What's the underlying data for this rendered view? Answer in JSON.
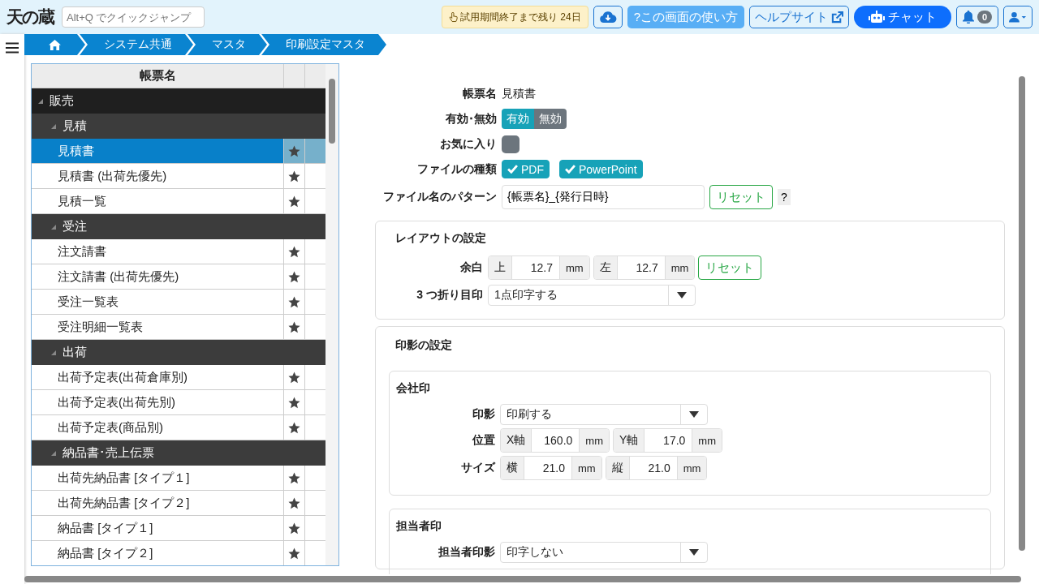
{
  "header": {
    "logo": "天の蔵",
    "quick_jump": {
      "placeholder": "Alt+Q でクイックジャンプ"
    },
    "trial_badge": "試用期間終了まで残り 24日",
    "usage_button": "?この画面の使い方",
    "help_site_button": "ヘルプサイト",
    "chat_button": "チャット",
    "notification_count": "0"
  },
  "breadcrumb": [
    "システム共通",
    "マスタ",
    "印刷設定マスタ"
  ],
  "tree": {
    "column": "帳票名",
    "rows": [
      {
        "label": "販売",
        "expanded": true,
        "children": [
          {
            "label": "見積",
            "expanded": true,
            "children": [
              {
                "label": "見積書",
                "selected": true
              },
              {
                "label": "見積書 (出荷先優先)",
                "selected": false
              },
              {
                "label": "見積一覧",
                "selected": false
              }
            ]
          },
          {
            "label": "受注",
            "expanded": true,
            "children": [
              {
                "label": "注文請書",
                "selected": false
              },
              {
                "label": "注文請書 (出荷先優先)",
                "selected": false
              },
              {
                "label": "受注一覧表",
                "selected": false
              },
              {
                "label": "受注明細一覧表",
                "selected": false
              }
            ]
          },
          {
            "label": "出荷",
            "expanded": true,
            "children": [
              {
                "label": "出荷予定表(出荷倉庫別)",
                "selected": false
              },
              {
                "label": "出荷予定表(出荷先別)",
                "selected": false
              },
              {
                "label": "出荷予定表(商品別)",
                "selected": false
              }
            ]
          },
          {
            "label": "納品書･売上伝票",
            "expanded": true,
            "children": [
              {
                "label": "出荷先納品書 [タイプ１]",
                "selected": false
              },
              {
                "label": "出荷先納品書 [タイプ２]",
                "selected": false
              },
              {
                "label": "納品書 [タイプ１]",
                "selected": false
              },
              {
                "label": "納品書 [タイプ２]",
                "selected": false
              }
            ]
          }
        ]
      }
    ]
  },
  "form": {
    "name_label": "帳票名",
    "name_value": "見積書",
    "status_label": "有効･無効",
    "status_options": [
      {
        "label": "有効",
        "selected": true
      },
      {
        "label": "無効",
        "selected": false
      }
    ],
    "favorite_label": "お気に入り",
    "favorite": {
      "checked": false
    },
    "file_type_label": "ファイルの種類",
    "file_types": [
      {
        "label": "PDF",
        "checked": true
      },
      {
        "label": "PowerPoint",
        "checked": true
      }
    ],
    "pattern_label": "ファイル名のパターン",
    "pattern_value": "{帳票名}_{発行日時}",
    "reset_button": "リセット",
    "help_mark": "?"
  },
  "layout_card": {
    "title": "レイアウトの設定",
    "margin_label": "余白",
    "margins": [
      {
        "prefix": "上",
        "value": "12.7",
        "unit": "mm"
      },
      {
        "prefix": "左",
        "value": "12.7",
        "unit": "mm"
      }
    ],
    "reset_button": "リセット",
    "fold_label": "3 つ折り目印",
    "fold_value": "1点印字する"
  },
  "stamp_card": {
    "title": "印影の設定",
    "sections": [
      {
        "title": "会社印",
        "stamp_label": "印影",
        "stamp_value": "印刷する",
        "position_label": "位置",
        "position": [
          {
            "prefix": "X軸",
            "value": "160.0",
            "unit": "mm"
          },
          {
            "prefix": "Y軸",
            "value": "17.0",
            "unit": "mm"
          }
        ],
        "size_label": "サイズ",
        "size": [
          {
            "prefix": "横",
            "value": "21.0",
            "unit": "mm"
          },
          {
            "prefix": "縦",
            "value": "21.0",
            "unit": "mm"
          }
        ]
      },
      {
        "title": "担当者印",
        "stamp_label": "担当者印影",
        "stamp_value": "印字しない"
      }
    ]
  }
}
